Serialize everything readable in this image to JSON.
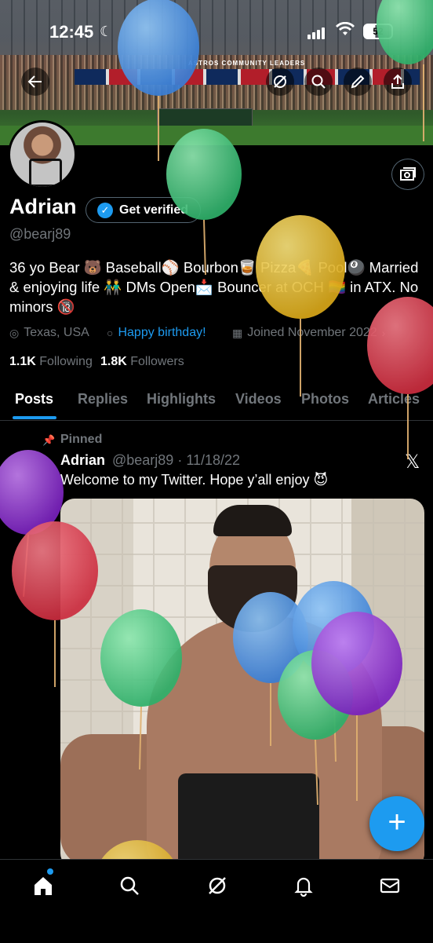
{
  "status_bar": {
    "time": "12:45",
    "battery": "52"
  },
  "banner": {
    "sign_text": "ASTROS COMMUNITY LEADERS"
  },
  "profile": {
    "name": "Adrian",
    "get_verified_label": "Get verified",
    "handle": "@bearj89",
    "bio": "36 yo Bear 🐻 Baseball⚾️ Bourbon🥃 Pizza🍕 Pool🎱 Married & enjoying life 👬 DMs Open📩 Bouncer at OCH 🏳️‍🌈 in ATX. No minors 🔞",
    "location": "Texas, USA",
    "birthday": "Happy birthday!",
    "joined": "Joined November 2022",
    "following_count": "1.1K",
    "following_label": "Following",
    "followers_count": "1.8K",
    "followers_label": "Followers"
  },
  "tabs": [
    "Posts",
    "Replies",
    "Highlights",
    "Videos",
    "Photos",
    "Articles"
  ],
  "active_tab": "Posts",
  "pinned_post": {
    "pinned_label": "Pinned",
    "author": "Adrian",
    "handle_date": "@bearj89 · 11/18/22",
    "text": "Welcome to my Twitter. Hope y’all enjoy 😈"
  },
  "icons": {
    "back": "back-arrow-icon",
    "grok": "grok-icon",
    "search": "search-icon",
    "compose": "compose-icon",
    "share": "share-icon",
    "photo": "photo-icon",
    "fab": "plus-icon",
    "nav": [
      "home-icon",
      "search-icon",
      "grok-icon",
      "notifications-icon",
      "messages-icon"
    ]
  },
  "colors": {
    "accent": "#1d9bf0",
    "muted": "#71767b",
    "background": "#000000",
    "balloons": [
      "#4a90d9",
      "#3ec27a",
      "#e6b92a",
      "#d93a4a",
      "#8a2fc9"
    ]
  }
}
